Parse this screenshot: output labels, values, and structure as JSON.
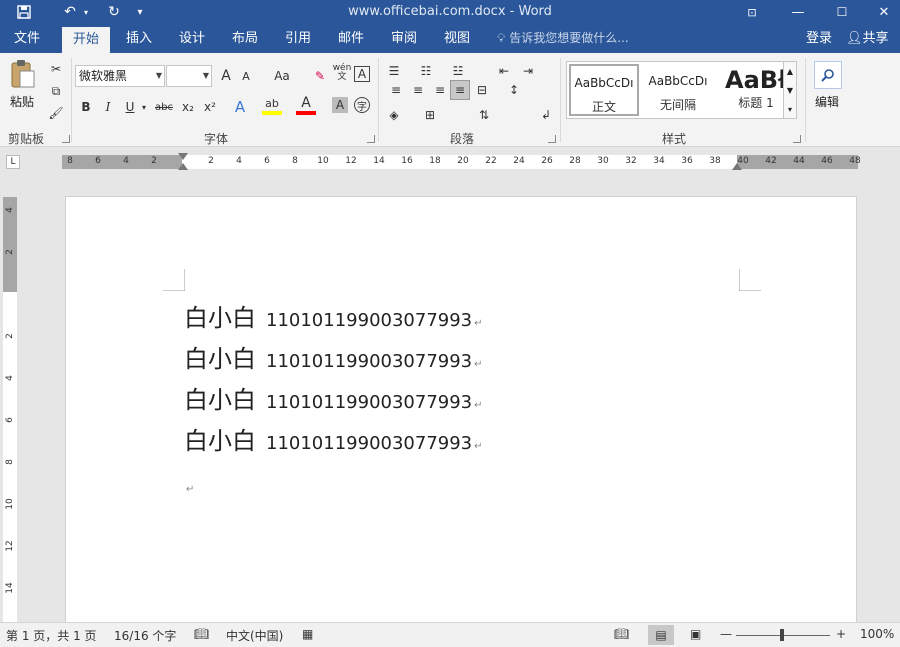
{
  "title": {
    "text": "www.officebai.com.docx - Word"
  },
  "tabs": [
    "文件",
    "开始",
    "插入",
    "设计",
    "布局",
    "引用",
    "邮件",
    "审阅",
    "视图"
  ],
  "tellme": "告诉我您想要做什么...",
  "account": {
    "login": "登录",
    "share": "共享"
  },
  "ribbon": {
    "clipboard": {
      "paste": "粘贴",
      "label": "剪贴板"
    },
    "font": {
      "name": "微软雅黑",
      "size": "",
      "label": "字体",
      "bold": "B",
      "italic": "I",
      "underline": "U",
      "strike": "abc",
      "sub": "x₂",
      "sup": "x²",
      "wen": "wén",
      "wen_char": "文",
      "effect": "A",
      "color": "A",
      "shade": "A",
      "enclose": "字",
      "grow": "A",
      "shrink": "A",
      "case": "Aa"
    },
    "paragraph": {
      "label": "段落"
    },
    "styles": {
      "label": "样式",
      "items": [
        {
          "preview": "AaBbCcDı",
          "name": "正文"
        },
        {
          "preview": "AaBbCcDı",
          "name": "无间隔"
        },
        {
          "preview": "AaBł",
          "name": "标题 1"
        }
      ]
    },
    "editing": {
      "label": "编辑"
    }
  },
  "ruler": {
    "tab_selector": "L",
    "left_numbers": [
      "8",
      "6",
      "4",
      "2"
    ],
    "right_numbers": [
      "2",
      "4",
      "6",
      "8",
      "10",
      "12",
      "14",
      "16",
      "18",
      "20",
      "22",
      "24",
      "26",
      "28",
      "30",
      "32",
      "34",
      "36",
      "38",
      "40",
      "42",
      "44",
      "46",
      "48"
    ],
    "vertical_numbers": [
      "4",
      "2",
      "",
      "2",
      "4",
      "6",
      "8",
      "10",
      "12",
      "14",
      "16"
    ]
  },
  "document": {
    "lines": [
      {
        "name": "白小白",
        "id": "110101199003077993"
      },
      {
        "name": "白小白",
        "id": "110101199003077993"
      },
      {
        "name": "白小白",
        "id": "110101199003077993"
      },
      {
        "name": "白小白",
        "id": "110101199003077993"
      }
    ],
    "paragraph_mark": "↵"
  },
  "status": {
    "page": "第 1 页，共 1 页",
    "words": "16/16 个字",
    "language": "中文(中国)",
    "zoom": "100%"
  },
  "colors": {
    "accent": "#2b579a",
    "highlight": "#ffff00",
    "font_color": "#ff0000"
  }
}
